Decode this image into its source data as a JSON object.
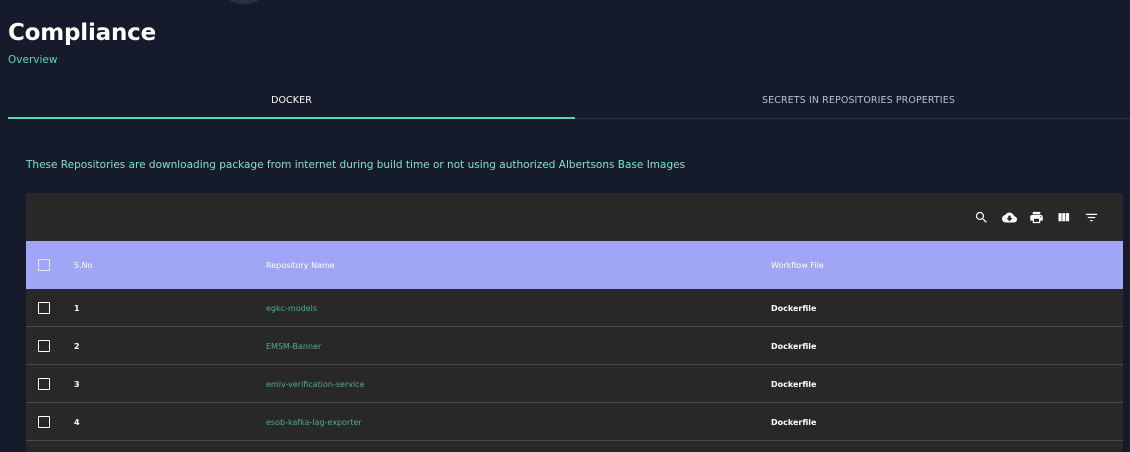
{
  "header": {
    "title": "Compliance",
    "subtitle": "Overview"
  },
  "tabs": [
    {
      "label": "DOCKER",
      "active": true
    },
    {
      "label": "SECRETS IN REPOSITORIES PROPERTIES",
      "active": false
    }
  ],
  "info_text": "These Repositories are downloading package from internet during build time or not using authorized Albertsons Base Images",
  "toolbar": {
    "icons": [
      "search-icon",
      "download-icon",
      "print-icon",
      "columns-icon",
      "filter-icon"
    ]
  },
  "table": {
    "columns": [
      "S.No",
      "Repository Name",
      "Workflow File"
    ],
    "rows": [
      {
        "sno": "1",
        "repo": "egkc-models",
        "workflow": "Dockerfile"
      },
      {
        "sno": "2",
        "repo": "EMSM-Banner",
        "workflow": "Dockerfile"
      },
      {
        "sno": "3",
        "repo": "emiv-verification-service",
        "workflow": "Dockerfile"
      },
      {
        "sno": "4",
        "repo": "esob-kafka-lag-exporter",
        "workflow": "Dockerfile"
      }
    ]
  },
  "colors": {
    "background": "#161b2b",
    "accent": "#5fd3b0",
    "table_header": "#a0a6f5",
    "table_body": "#282828"
  }
}
